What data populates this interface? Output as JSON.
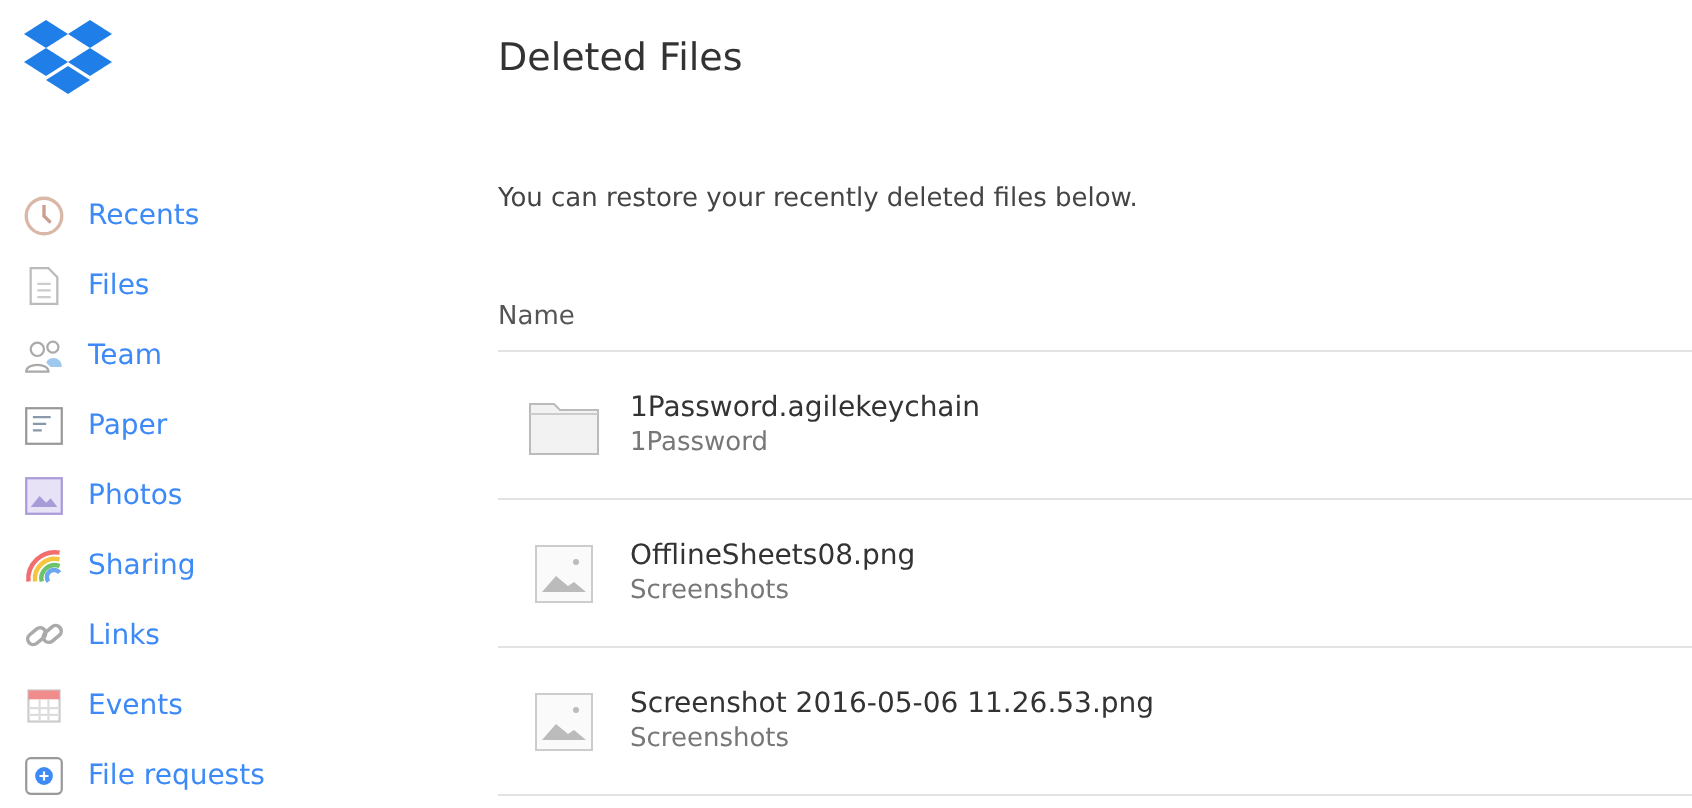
{
  "sidebar": {
    "items": [
      {
        "label": "Recents",
        "kind": "clock"
      },
      {
        "label": "Files",
        "kind": "file"
      },
      {
        "label": "Team",
        "kind": "team"
      },
      {
        "label": "Paper",
        "kind": "paper"
      },
      {
        "label": "Photos",
        "kind": "photos"
      },
      {
        "label": "Sharing",
        "kind": "rainbow"
      },
      {
        "label": "Links",
        "kind": "link"
      },
      {
        "label": "Events",
        "kind": "calendar"
      },
      {
        "label": "File requests",
        "kind": "request"
      }
    ]
  },
  "main": {
    "title": "Deleted Files",
    "subtitle": "You can restore your recently deleted files below.",
    "table": {
      "columns": [
        "Name"
      ],
      "rows": [
        {
          "kind": "folder",
          "name": "1Password.agilekeychain",
          "location": "1Password"
        },
        {
          "kind": "image",
          "name": "OfflineSheets08.png",
          "location": "Screenshots"
        },
        {
          "kind": "image",
          "name": "Screenshot 2016-05-06 11.26.53.png",
          "location": "Screenshots"
        }
      ]
    }
  }
}
